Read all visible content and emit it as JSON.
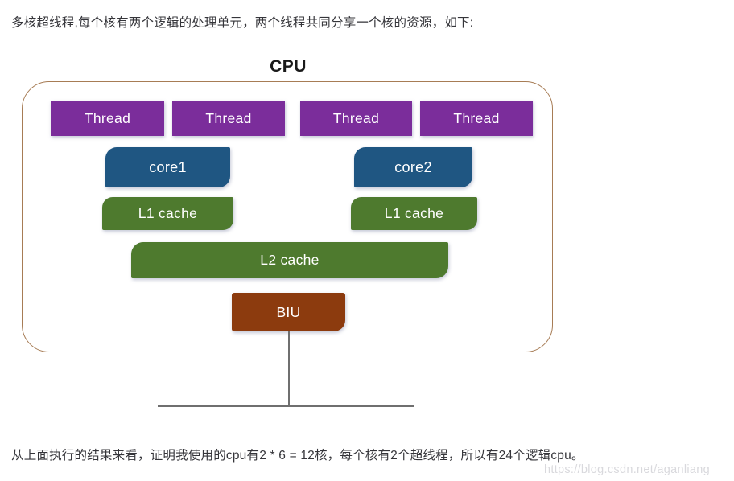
{
  "intro_text": "多核超线程,每个核有两个逻辑的处理单元，两个线程共同分享一个核的资源，如下:",
  "conclusion_text": "从上面执行的结果来看，证明我使用的cpu有2 * 6 = 12核，每个核有2个超线程，所以有24个逻辑cpu。",
  "watermark": "https://blog.csdn.net/aganliang",
  "diagram": {
    "title": "CPU",
    "threads": [
      {
        "label": "Thread"
      },
      {
        "label": "Thread"
      },
      {
        "label": "Thread"
      },
      {
        "label": "Thread"
      }
    ],
    "cores": [
      {
        "label": "core1"
      },
      {
        "label": "core2"
      }
    ],
    "l1_caches": [
      {
        "label": "L1 cache"
      },
      {
        "label": "L1 cache"
      }
    ],
    "l2_cache": {
      "label": "L2 cache"
    },
    "biu": {
      "label": "BIU"
    }
  },
  "colors": {
    "thread": "#7b2d9b",
    "core": "#1f5682",
    "cache": "#4e7a2e",
    "biu": "#8c3b0e",
    "cpu_border": "#a77c55",
    "bus": "#6f6f6f",
    "text": "#35353a",
    "watermark": "#d9d9dd"
  }
}
